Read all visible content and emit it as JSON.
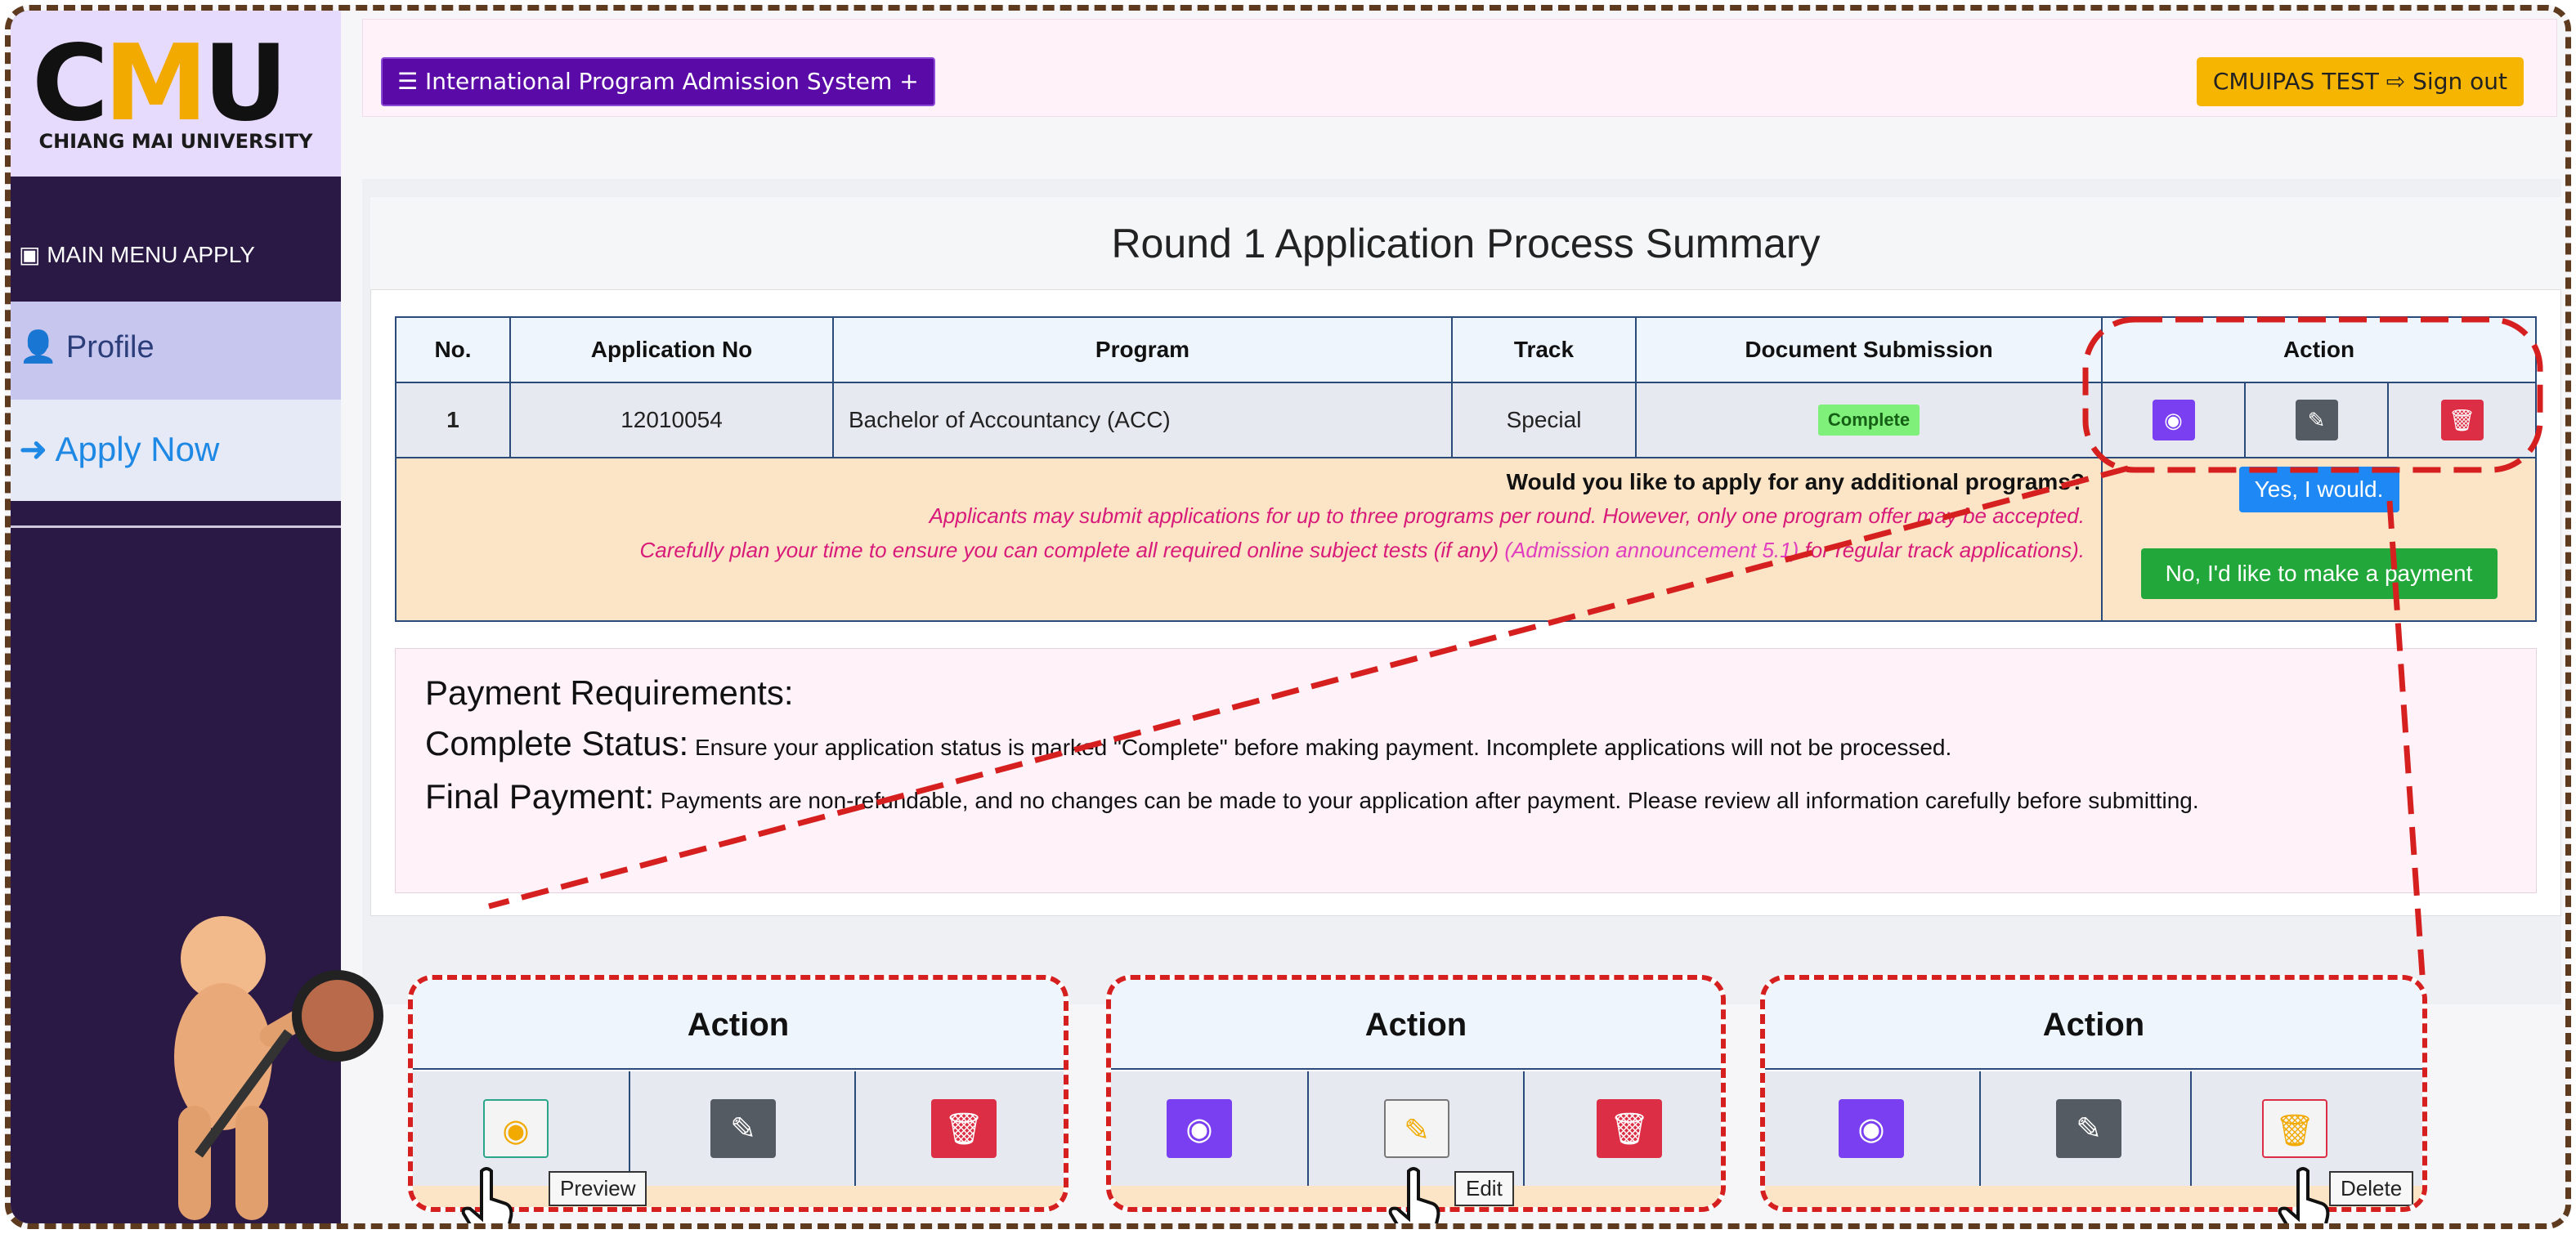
{
  "sidebar": {
    "logo_mark": "CMU",
    "logo_text": "CHIANG MAI UNIVERSITY",
    "menu_header": "MAIN MENU APPLY",
    "items": [
      {
        "label": "Profile",
        "icon": "user-icon"
      },
      {
        "label": "Apply Now",
        "icon": "arrow-circle-right-icon"
      }
    ]
  },
  "topbar": {
    "brand": "International Program Admission System +",
    "user_signout": "CMUIPAS TEST ⇨ Sign out"
  },
  "main": {
    "title": "Round 1 Application Process Summary",
    "table": {
      "headers": [
        "No.",
        "Application No",
        "Program",
        "Track",
        "Document Submission",
        "Action"
      ],
      "rows": [
        {
          "no": "1",
          "app_no": "12010054",
          "program": "Bachelor of Accountancy (ACC)",
          "track": "Special",
          "status": "Complete"
        }
      ]
    },
    "additional": {
      "question": "Would you like to apply for any additional programs?",
      "line1": "Applicants may submit applications for up to three programs per round. However, only one program offer may be accepted.",
      "line2_pre": "Carefully plan your time to ensure you can complete all required online subject tests (if any)",
      "line2_link": "(Admission announcement 5.1)",
      "line2_post": "for regular track applications).",
      "yes": "Yes, I would.",
      "no": "No, I'd like to make a payment"
    },
    "payment": {
      "heading": "Payment Requirements:",
      "status_label": "Complete Status:",
      "status_text": "Ensure your application status is marked \"Complete\" before making payment. Incomplete applications will not be processed.",
      "final_label": "Final Payment:",
      "final_text": "Payments are non-refundable, and no changes can be made to your application after payment. Please review all information carefully before submitting."
    }
  },
  "callouts": [
    {
      "header": "Action",
      "tooltip": "Preview"
    },
    {
      "header": "Action",
      "tooltip": "Edit"
    },
    {
      "header": "Action",
      "tooltip": "Delete"
    }
  ],
  "colors": {
    "view": "#7a3ff0",
    "edit": "#555b62",
    "delete": "#dc2f45",
    "sidebar": "#2a1845",
    "accent": "#d62020"
  }
}
